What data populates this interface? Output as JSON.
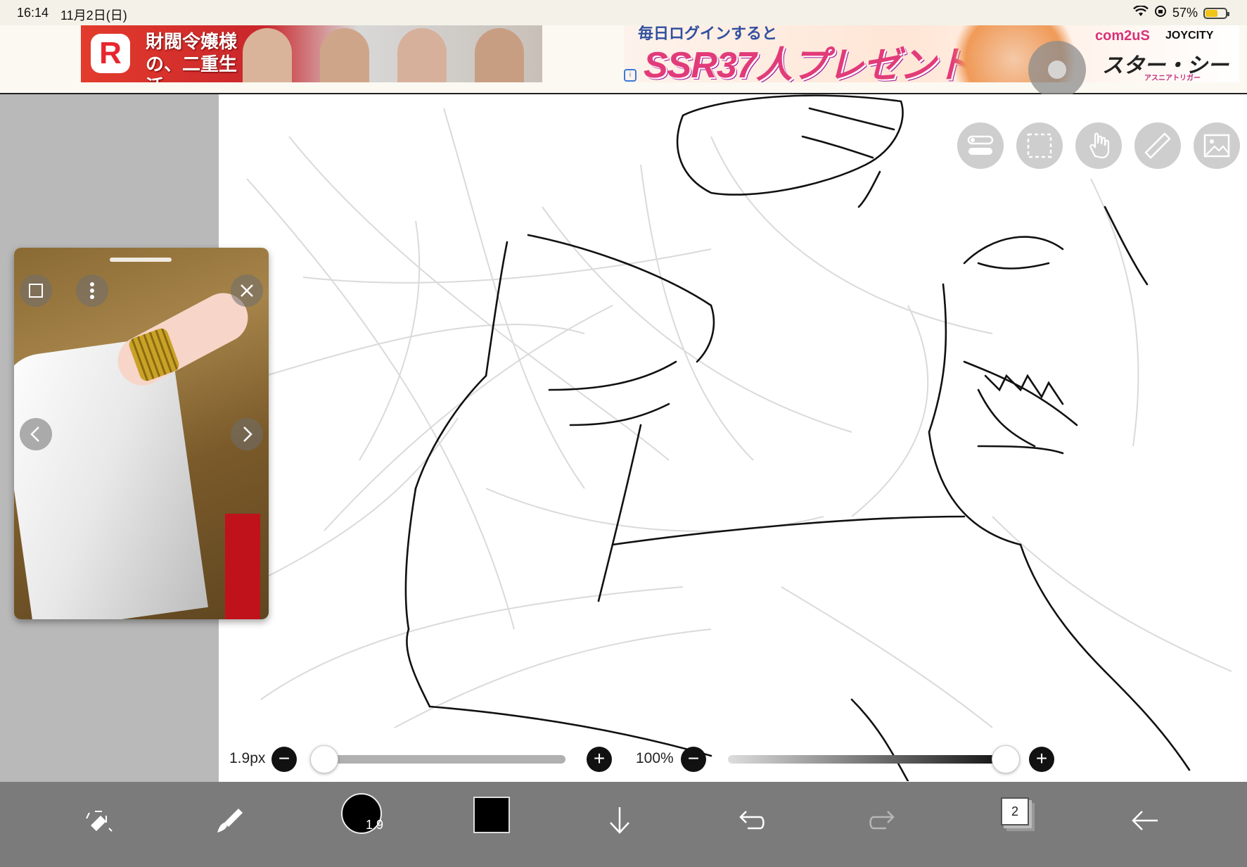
{
  "status_bar": {
    "time": "16:14",
    "date": "11月2日(日)",
    "battery": "57%"
  },
  "ads": {
    "left": {
      "logo": "R",
      "title": "財閥令嬢様の、二重生活"
    },
    "right": {
      "top_text": "毎日ログインすると",
      "headline": "SSR37人プレゼント!",
      "brand1": "com2uS",
      "brand2": "JOYCITY",
      "game_title": "スター・シード",
      "game_sub": "アスニアトリガー"
    }
  },
  "reference_window": {
    "close_icon": "close-icon",
    "menu_icon": "more-vertical-icon",
    "expand_icon": "expand-icon",
    "prev_icon": "chevron-left-icon",
    "next_icon": "chevron-right-icon"
  },
  "canvas_tools": [
    {
      "name": "layer-settings-icon"
    },
    {
      "name": "selection-icon"
    },
    {
      "name": "hand-tool-icon"
    },
    {
      "name": "ruler-icon"
    },
    {
      "name": "image-icon"
    }
  ],
  "brush_slider": {
    "label": "1.9px",
    "value_fraction": 0.0
  },
  "opacity_slider": {
    "label": "100%",
    "value_fraction": 1.0
  },
  "toolbar": {
    "brush_size": "1.9",
    "layer_count": "2",
    "active_color": "#000000"
  }
}
